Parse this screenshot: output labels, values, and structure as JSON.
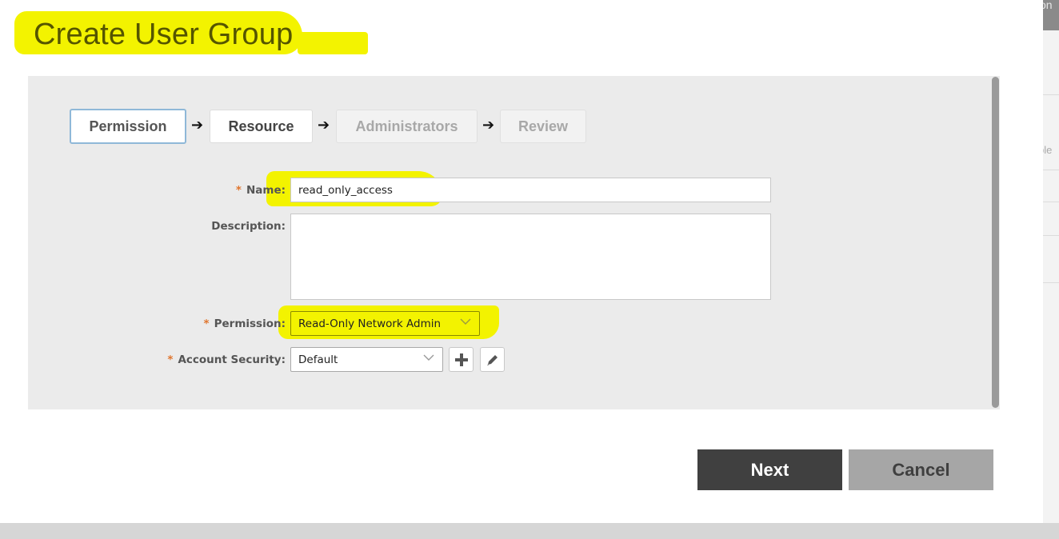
{
  "background": {
    "partial_top_text": "on",
    "partial_side_text": "ble"
  },
  "dialog": {
    "title": "Create User Group",
    "steps": [
      {
        "label": "Permission",
        "state": "active"
      },
      {
        "label": "Resource",
        "state": "enabled"
      },
      {
        "label": "Administrators",
        "state": "disabled"
      },
      {
        "label": "Review",
        "state": "disabled"
      }
    ],
    "step_separator_icon": "arrow-right-icon",
    "form": {
      "name": {
        "label": "Name:",
        "required": "*",
        "value": "read_only_access"
      },
      "description": {
        "label": "Description:",
        "value": ""
      },
      "permission": {
        "label": "Permission:",
        "required": "*",
        "selected": "Read-Only Network Admin"
      },
      "account_security": {
        "label": "Account Security:",
        "required": "*",
        "selected": "Default",
        "add_icon": "plus-icon",
        "edit_icon": "pencil-icon"
      }
    },
    "buttons": {
      "next": "Next",
      "cancel": "Cancel"
    }
  },
  "colors": {
    "highlight": "#f3f300",
    "required": "#e0752d",
    "active_step_border": "#8fb8d8",
    "next_bg": "#404040",
    "cancel_bg": "#a6a6a6"
  }
}
